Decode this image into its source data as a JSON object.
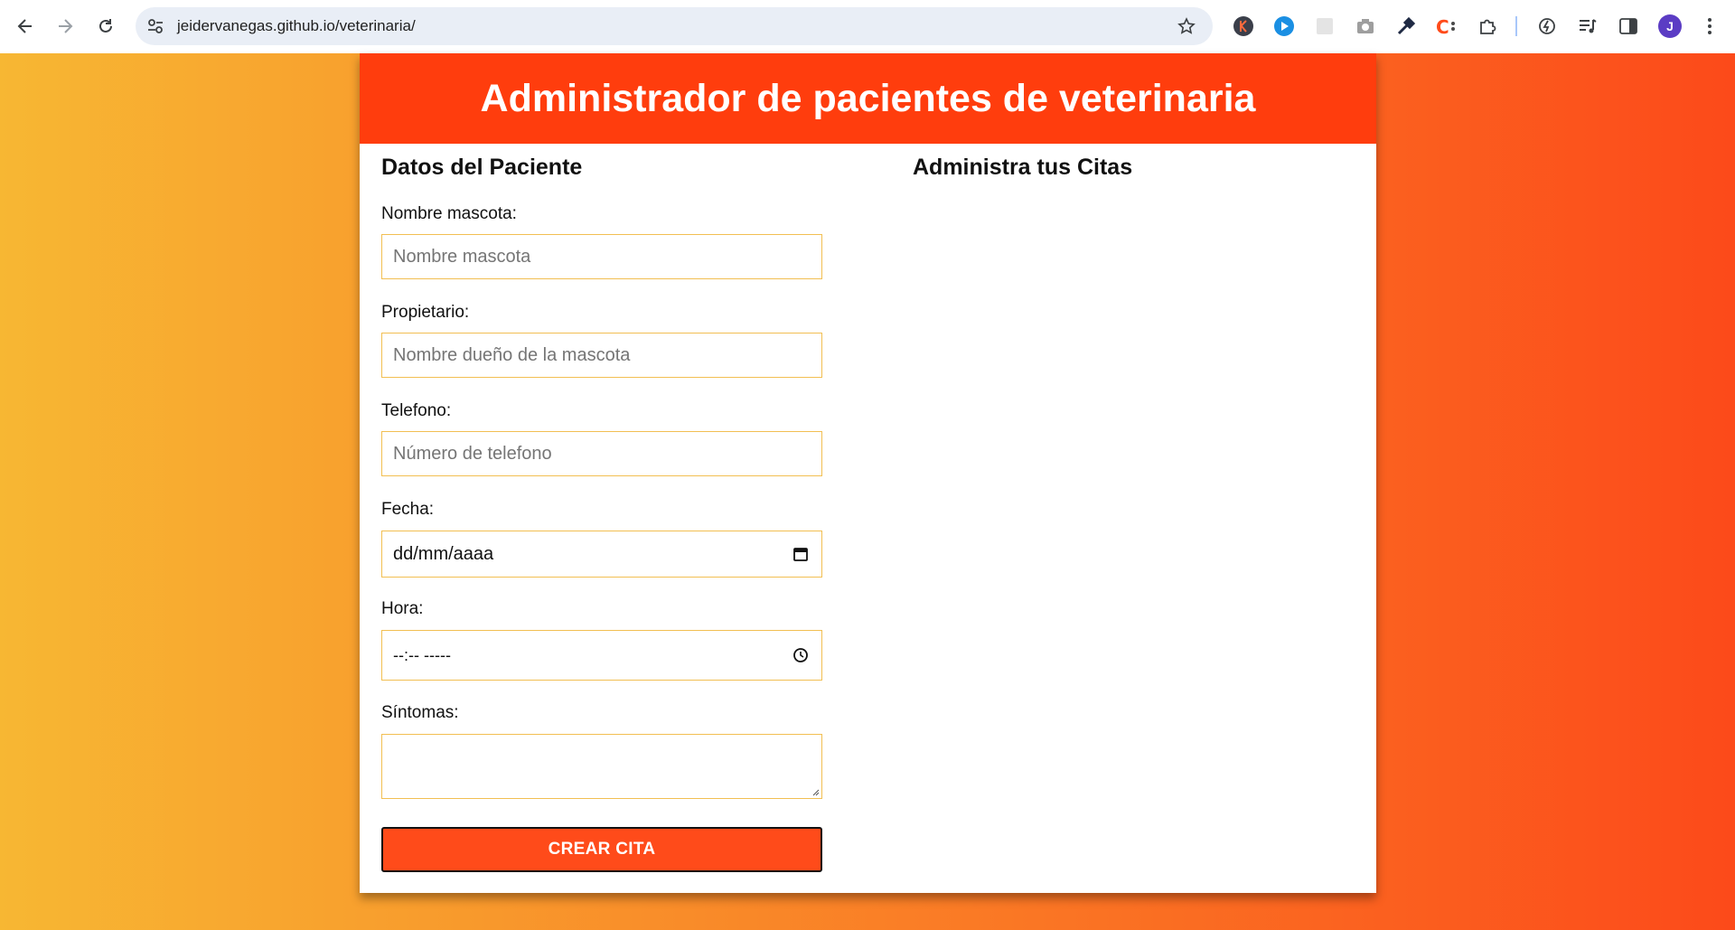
{
  "browser": {
    "url": "jeidervanegas.github.io/veterinaria/",
    "profile_initial": "J",
    "nav": [
      "back-icon",
      "forward-icon",
      "reload-icon"
    ],
    "extensions": [
      "k-extension-icon",
      "video-extension-icon",
      "blank-extension-icon",
      "camera-icon",
      "eyedropper-icon",
      "c-extension-icon",
      "puzzle-icon",
      "performance-icon",
      "media-icon",
      "side-panel-icon"
    ]
  },
  "page": {
    "title": "Administrador de pacientes de veterinaria",
    "form_title": "Datos del Paciente",
    "list_title": "Administra tus Citas",
    "fields": {
      "pet": {
        "label": "Nombre mascota:",
        "placeholder": "Nombre mascota"
      },
      "owner": {
        "label": "Propietario:",
        "placeholder": "Nombre dueño de la mascota"
      },
      "phone": {
        "label": "Telefono:",
        "placeholder": "Número de telefono"
      },
      "date": {
        "label": "Fecha:",
        "value": "dd/mm/aaaa"
      },
      "time": {
        "label": "Hora:",
        "value": "--:-- -----"
      },
      "symptoms": {
        "label": "Síntomas:"
      }
    },
    "submit_label": "CREAR CITA"
  },
  "colors": {
    "header": "#ff3d0d",
    "button": "#ff4b1a",
    "gradient_start": "#f7b733",
    "gradient_end": "#fc4a1a",
    "field_border": "#f2bf52"
  }
}
